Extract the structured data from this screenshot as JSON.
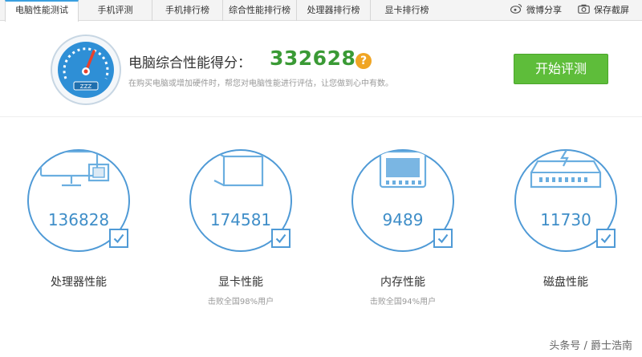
{
  "tabs": [
    {
      "label": "电脑性能测试",
      "active": true
    },
    {
      "label": "手机评测"
    },
    {
      "label": "手机排行榜"
    },
    {
      "label": "综合性能排行榜"
    },
    {
      "label": "处理器排行榜"
    },
    {
      "label": "显卡排行榜"
    }
  ],
  "share": {
    "weibo": "微博分享",
    "save": "保存截屏"
  },
  "header": {
    "score_label": "电脑综合性能得分：",
    "score": "332628",
    "help_icon_text": "?",
    "subtext": "在购买电脑或增加硬件时，帮您对电脑性能进行评估，让您做到心中有数。",
    "start_button": "开始评测",
    "gauge_badge": "ZZZ"
  },
  "components": [
    {
      "name": "处理器性能",
      "score": "136828",
      "sub": "",
      "icon": "cpu-monitor-icon"
    },
    {
      "name": "显卡性能",
      "score": "174581",
      "sub": "击败全国98%用户",
      "icon": "graphics-card-icon"
    },
    {
      "name": "内存性能",
      "score": "9489",
      "sub": "击败全国94%用户",
      "icon": "memory-chip-icon"
    },
    {
      "name": "磁盘性能",
      "score": "11730",
      "sub": "",
      "icon": "hard-disk-icon"
    }
  ],
  "watermark": "头条号 / 爵士浩南",
  "colors": {
    "accent_blue": "#3f8ec8",
    "score_green": "#3a9a35",
    "button_green": "#5ebd3a",
    "help_orange": "#f0a524"
  }
}
